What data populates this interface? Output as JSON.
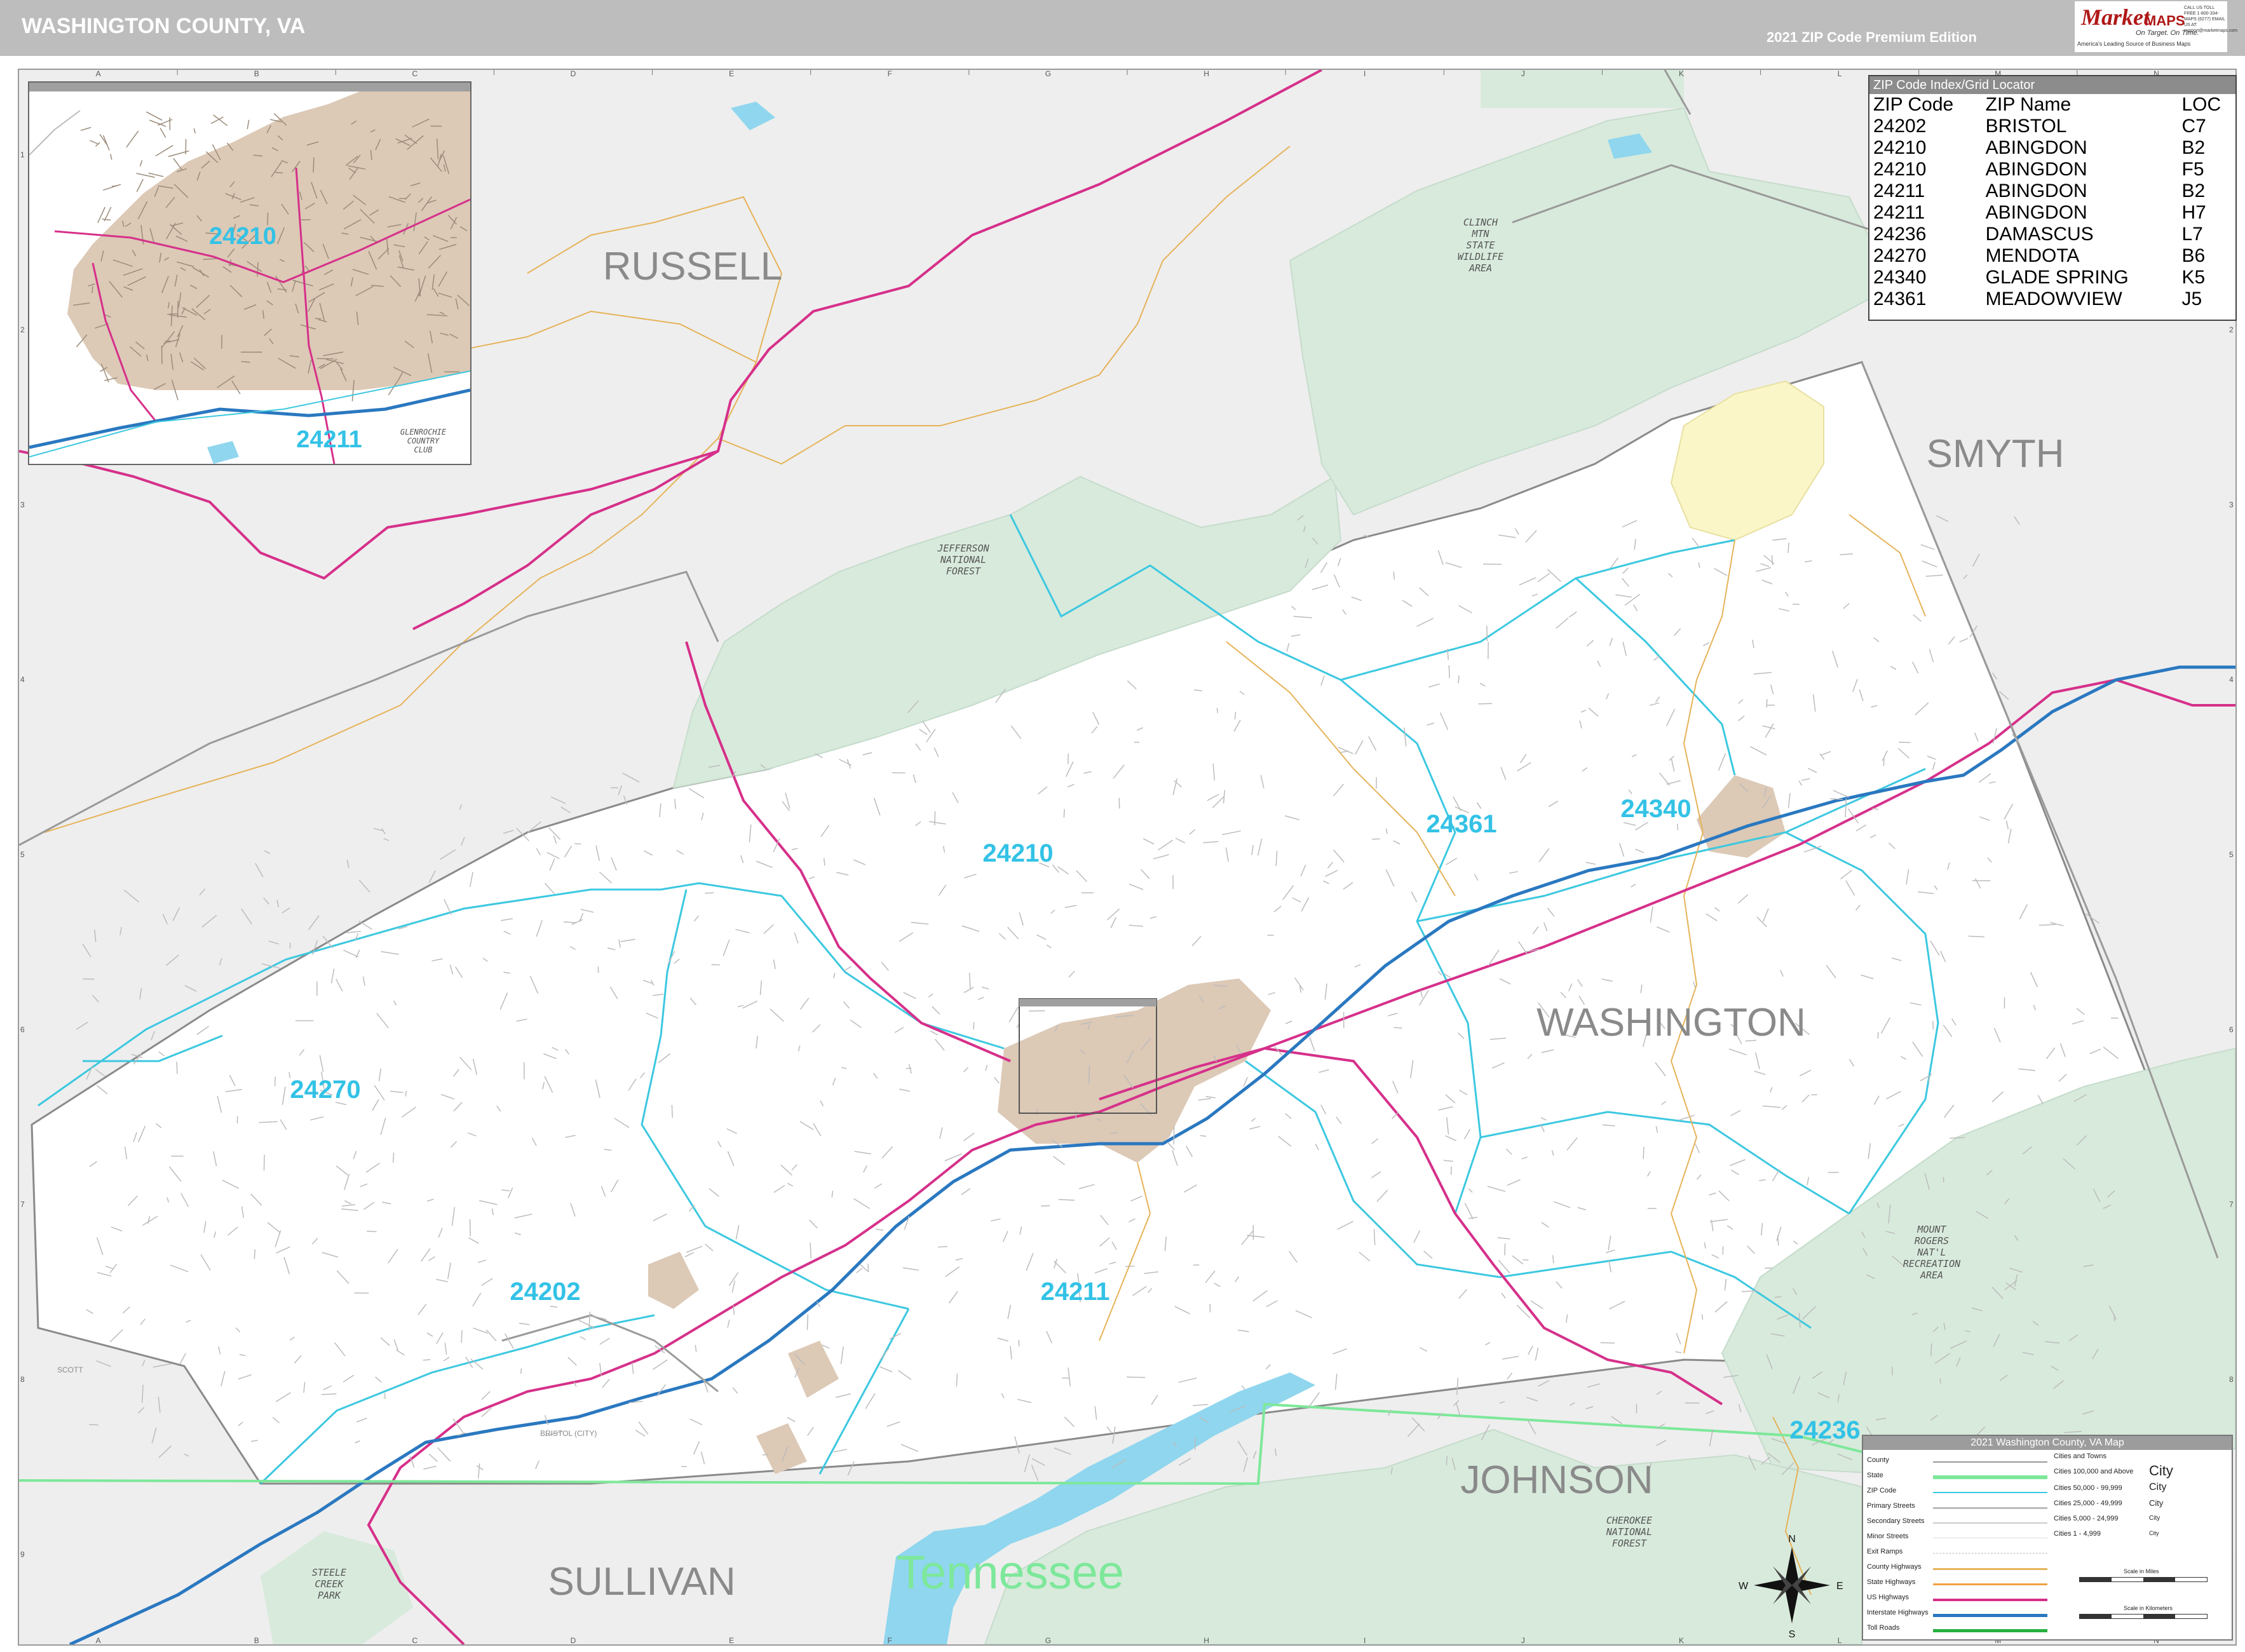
{
  "header": {
    "title": "WASHINGTON COUNTY, VA",
    "edition": "2021 ZIP Code Premium Edition",
    "logo_word1": "Market",
    "logo_word2": "MAPS",
    "logo_tagline": "On Target. On Time.",
    "logo_slogan": "America's Leading Source of Business Maps",
    "logo_contact": "CALL US TOLL FREE 1-800-334-MAPS (6277) EMAIL US AT: support@marketmaps.com"
  },
  "grid": {
    "columns": [
      "A",
      "B",
      "C",
      "D",
      "E",
      "F",
      "G",
      "H",
      "I",
      "J",
      "K",
      "L",
      "M",
      "N"
    ],
    "rows": [
      "1",
      "2",
      "3",
      "4",
      "5",
      "6",
      "7",
      "8",
      "9"
    ]
  },
  "regions": {
    "russell": "RUSSELL",
    "smyth": "SMYTH",
    "washington": "WASHINGTON",
    "johnson": "JOHNSON",
    "sullivan": "SULLIVAN",
    "tennessee": "Tennessee",
    "scott": "SCOTT",
    "bristol_city": "BRISTOL (CITY)"
  },
  "parks": {
    "clinch": "CLINCH MTN STATE WILDLIFE AREA",
    "jefferson": "JEFFERSON NATIONAL FOREST",
    "mount_rogers": "MOUNT ROGERS NAT'L RECREATION AREA",
    "cherokee": "CHEROKEE NATIONAL FOREST",
    "steele_creek": "STEELE CREEK PARK",
    "glenrochie": "GLENROCHIE COUNTRY CLUB"
  },
  "zip_labels": {
    "z24210": "24210",
    "z24361": "24361",
    "z24340": "24340",
    "z24270": "24270",
    "z24202": "24202",
    "z24211": "24211",
    "z24236": "24236",
    "inset_24210": "24210",
    "inset_24211": "24211"
  },
  "zip_index": {
    "header": "ZIP Code Index/Grid Locator",
    "columns": [
      "ZIP Code",
      "ZIP Name",
      "LOC"
    ],
    "rows": [
      [
        "24202",
        "BRISTOL",
        "C7"
      ],
      [
        "24210",
        "ABINGDON",
        "B2"
      ],
      [
        "24210",
        "ABINGDON",
        "F5"
      ],
      [
        "24211",
        "ABINGDON",
        "B2"
      ],
      [
        "24211",
        "ABINGDON",
        "H7"
      ],
      [
        "24236",
        "DAMASCUS",
        "L7"
      ],
      [
        "24270",
        "MENDOTA",
        "B6"
      ],
      [
        "24340",
        "GLADE SPRING",
        "K5"
      ],
      [
        "24361",
        "MEADOWVIEW",
        "J5"
      ]
    ]
  },
  "legend": {
    "header": "2021 Washington County, VA Map",
    "items": [
      "County",
      "State",
      "ZIP Code",
      "Primary Streets",
      "Secondary Streets",
      "Minor Streets",
      "Exit Ramps",
      "County Highways",
      "State Highways",
      "US Highways",
      "Interstate Highways",
      "Toll Roads"
    ],
    "cities_header": "Cities and Towns",
    "cities": [
      {
        "range": "Cities 100,000 and Above",
        "sample": "City"
      },
      {
        "range": "Cities 50,000 - 99,999",
        "sample": "City"
      },
      {
        "range": "Cities 25,000 - 49,999",
        "sample": "City"
      },
      {
        "range": "Cities 5,000 - 24,999",
        "sample": "City"
      },
      {
        "range": "Cities 1 - 4,999",
        "sample": "City"
      }
    ],
    "scale_miles": "Scale in Miles",
    "scale_km": "Scale in Kilometers"
  },
  "compass": {
    "n": "N",
    "s": "S",
    "e": "E",
    "w": "W"
  },
  "colors": {
    "county_fill_outside": "#eeeeee",
    "park_green": "#d8eadc",
    "water_blue": "#8fd6ee",
    "urban_tan": "#dcc9b6",
    "zip_line": "#3cc8e0",
    "us_highway": "#d6308a",
    "interstate": "#2a78c0",
    "state_line": "#7de89a",
    "zip_text": "#33c2e6",
    "region_text": "#8a8a8a"
  }
}
